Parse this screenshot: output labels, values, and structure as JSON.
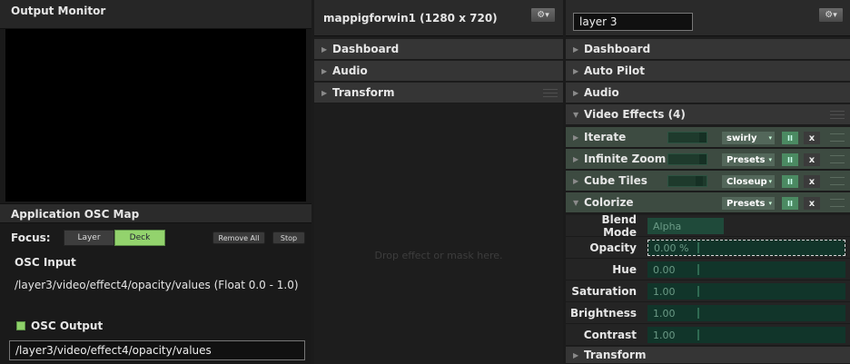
{
  "left": {
    "output_monitor_title": "Output Monitor",
    "osc_map_title": "Application OSC Map",
    "focus_label": "Focus:",
    "focus_options": [
      "Layer",
      "Deck"
    ],
    "focus_selected": "Deck",
    "remove_all_label": "Remove All",
    "stop_label": "Stop",
    "osc_input_label": "OSC Input",
    "osc_input_path": "/layer3/video/effect4/opacity/values (Float 0.0 - 1.0)",
    "osc_output_label": "OSC Output",
    "osc_output_checked": true,
    "osc_output_value": "/layer3/video/effect4/opacity/values"
  },
  "middle": {
    "title": "mappigforwin1 (1280 x 720)",
    "sections": [
      "Dashboard",
      "Audio",
      "Transform"
    ],
    "drop_hint": "Drop effect or mask here."
  },
  "right": {
    "layer_name": "layer 3",
    "sections_top": [
      "Dashboard",
      "Auto Pilot",
      "Audio"
    ],
    "video_effects_label": "Video Effects (4)",
    "effects": [
      {
        "name": "Iterate",
        "preset": "swirly"
      },
      {
        "name": "Infinite Zoom",
        "preset": "Presets"
      },
      {
        "name": "Cube Tiles",
        "preset": "Closeup"
      },
      {
        "name": "Colorize",
        "preset": "Presets"
      }
    ],
    "effect_x_label": "x",
    "effect_toggle_label": "II",
    "params": [
      {
        "label": "Blend Mode",
        "value": "Alpha"
      },
      {
        "label": "Opacity",
        "value": "0.00 %"
      },
      {
        "label": "Hue",
        "value": "0.00"
      },
      {
        "label": "Saturation",
        "value": "1.00"
      },
      {
        "label": "Brightness",
        "value": "1.00"
      },
      {
        "label": "Contrast",
        "value": "1.00"
      }
    ],
    "transform_label": "Transform"
  },
  "colors": {
    "accent_green": "#93d36d",
    "effect_row": "#3d4b41",
    "param_field": "#11352a"
  }
}
